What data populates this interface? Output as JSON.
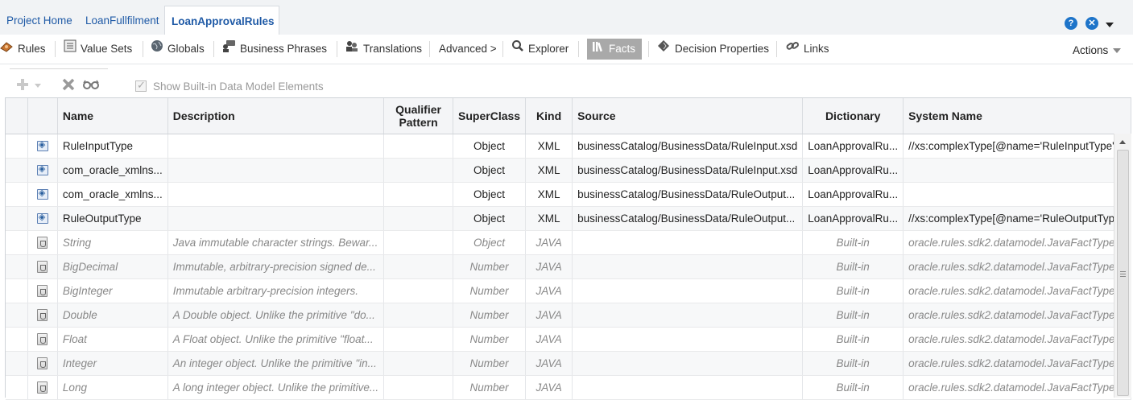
{
  "tabs": [
    {
      "label": "Project Home"
    },
    {
      "label": "LoanFullfilment"
    },
    {
      "label": "LoanApprovalRules",
      "active": true
    }
  ],
  "header_icons": {
    "help": "help-icon",
    "close": "close-icon",
    "menu": "chevron-down-icon"
  },
  "toolbar": {
    "rules": "Rules",
    "value_sets": "Value Sets",
    "globals": "Globals",
    "business_phrases": "Business Phrases",
    "translations": "Translations",
    "advanced": "Advanced >",
    "explorer": "Explorer",
    "facts": "Facts",
    "decision_properties": "Decision Properties",
    "links": "Links",
    "actions": "Actions"
  },
  "subtoolbar": {
    "show_builtin_label": "Show Built-in Data Model Elements",
    "show_builtin_checked": true
  },
  "table": {
    "headers": {
      "name": "Name",
      "description": "Description",
      "qualifier": "Qualifier Pattern",
      "superclass": "SuperClass",
      "kind": "Kind",
      "source": "Source",
      "dictionary": "Dictionary",
      "system_name": "System Name"
    },
    "rows": [
      {
        "icon": "xml-type-icon",
        "name": "RuleInputType",
        "description": "",
        "qualifier": "",
        "superclass": "Object",
        "kind": "XML",
        "source": "businessCatalog/BusinessData/RuleInput.xsd",
        "dictionary": "LoanApprovalRu...",
        "system_name": "//xs:complexType[@name='RuleInputType']"
      },
      {
        "icon": "xml-type-icon",
        "name": "com_oracle_xmlns...",
        "description": "",
        "qualifier": "",
        "superclass": "Object",
        "kind": "XML",
        "source": "businessCatalog/BusinessData/RuleInput.xsd",
        "dictionary": "LoanApprovalRu...",
        "system_name": ""
      },
      {
        "icon": "xml-type-icon",
        "name": "com_oracle_xmlns...",
        "description": "",
        "qualifier": "",
        "superclass": "Object",
        "kind": "XML",
        "source": "businessCatalog/BusinessData/RuleOutput...",
        "dictionary": "LoanApprovalRu...",
        "system_name": ""
      },
      {
        "icon": "xml-type-icon",
        "name": "RuleOutputType",
        "description": "",
        "qualifier": "",
        "superclass": "Object",
        "kind": "XML",
        "source": "businessCatalog/BusinessData/RuleOutput...",
        "dictionary": "LoanApprovalRu...",
        "system_name": "//xs:complexType[@name='RuleOutputType']"
      },
      {
        "icon": "java-type-icon",
        "name": "String",
        "description": "Java immutable character strings. Bewar...",
        "qualifier": "",
        "superclass": "Object",
        "kind": "JAVA",
        "source": "",
        "dictionary": "Built-in",
        "system_name": "oracle.rules.sdk2.datamodel.JavaFactType"
      },
      {
        "icon": "java-type-icon",
        "name": "BigDecimal",
        "description": "Immutable, arbitrary-precision signed de...",
        "qualifier": "",
        "superclass": "Number",
        "kind": "JAVA",
        "source": "",
        "dictionary": "Built-in",
        "system_name": "oracle.rules.sdk2.datamodel.JavaFactType"
      },
      {
        "icon": "java-type-icon",
        "name": "BigInteger",
        "description": "Immutable arbitrary-precision integers.",
        "qualifier": "",
        "superclass": "Number",
        "kind": "JAVA",
        "source": "",
        "dictionary": "Built-in",
        "system_name": "oracle.rules.sdk2.datamodel.JavaFactType"
      },
      {
        "icon": "java-type-icon",
        "name": "Double",
        "description": "A Double object. Unlike the primitive \"do...",
        "qualifier": "",
        "superclass": "Number",
        "kind": "JAVA",
        "source": "",
        "dictionary": "Built-in",
        "system_name": "oracle.rules.sdk2.datamodel.JavaFactType"
      },
      {
        "icon": "java-type-icon",
        "name": "Float",
        "description": "A Float object. Unlike the primitive \"float...",
        "qualifier": "",
        "superclass": "Number",
        "kind": "JAVA",
        "source": "",
        "dictionary": "Built-in",
        "system_name": "oracle.rules.sdk2.datamodel.JavaFactType"
      },
      {
        "icon": "java-type-icon",
        "name": "Integer",
        "description": "An integer object. Unlike the primitive \"in...",
        "qualifier": "",
        "superclass": "Number",
        "kind": "JAVA",
        "source": "",
        "dictionary": "Built-in",
        "system_name": "oracle.rules.sdk2.datamodel.JavaFactType"
      },
      {
        "icon": "java-type-icon",
        "name": "Long",
        "description": "A long integer object. Unlike the primitive...",
        "qualifier": "",
        "superclass": "Number",
        "kind": "JAVA",
        "source": "",
        "dictionary": "Built-in",
        "system_name": "oracle.rules.sdk2.datamodel.JavaFactType"
      }
    ]
  }
}
